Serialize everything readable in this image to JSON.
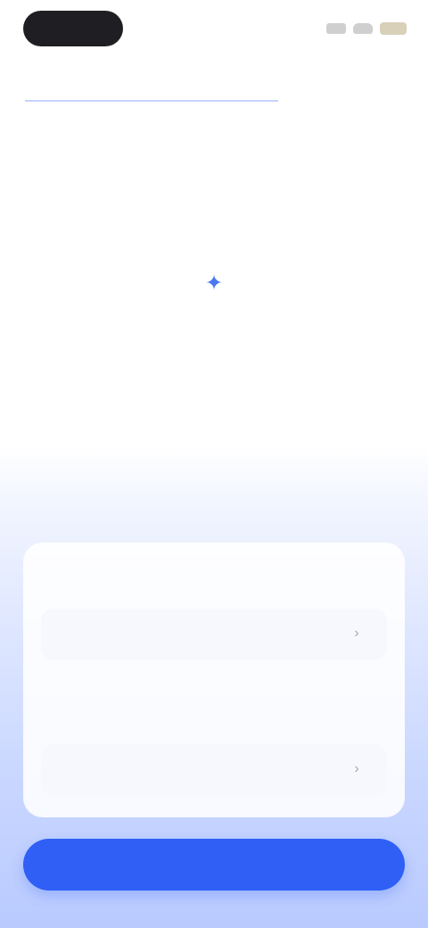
{
  "status_bar": {
    "icons": [
      "signal-icon",
      "wifi-icon",
      "battery-icon"
    ]
  },
  "header": {
    "link_text": ""
  },
  "empty_state": {
    "icon": "sparkle-icon",
    "message": ""
  },
  "form": {
    "field1_label": "",
    "field1_value": "",
    "field2_label": "",
    "field2_value": ""
  },
  "actions": {
    "primary_label": ""
  },
  "colors": {
    "accent": "#2f5ff5",
    "link": "#3b6cf0"
  }
}
